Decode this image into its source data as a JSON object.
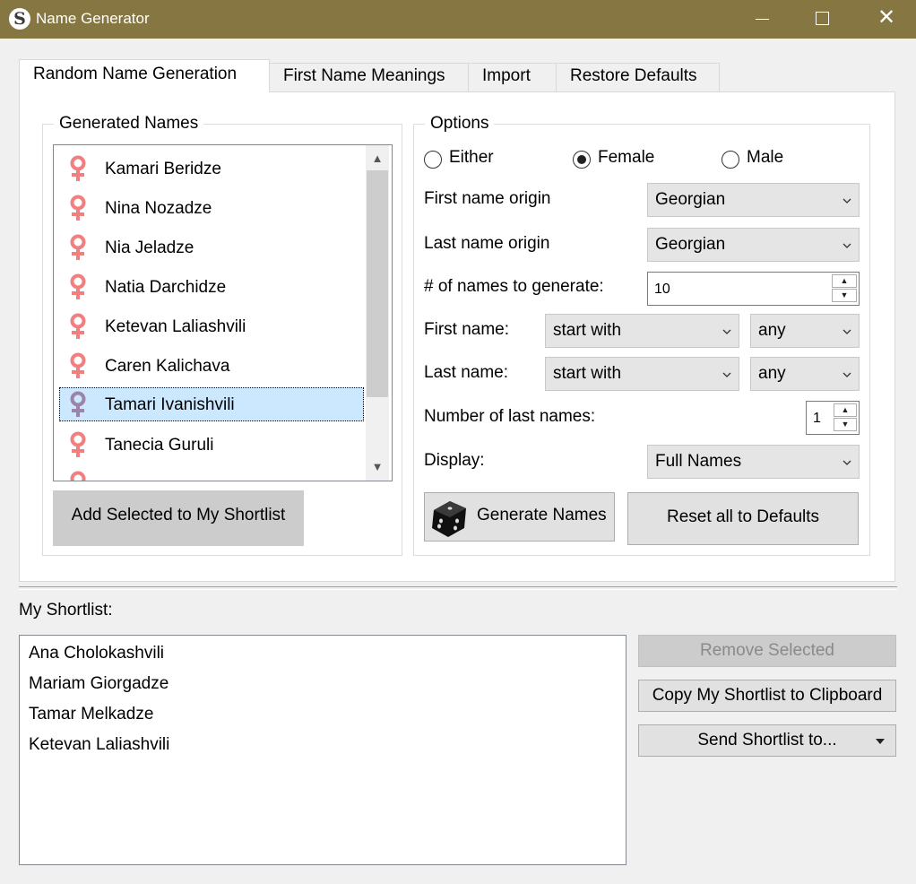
{
  "window": {
    "app_icon_letter": "S",
    "title": "Name Generator",
    "minimize_icon": "minimize-icon",
    "maximize_icon": "maximize-icon",
    "close_icon": "close-icon",
    "titlebar_color": "#867742"
  },
  "tabs": [
    {
      "label": "Random Name Generation",
      "active": true
    },
    {
      "label": "First Name Meanings",
      "active": false
    },
    {
      "label": "Import",
      "active": false
    },
    {
      "label": "Restore Defaults",
      "active": false
    }
  ],
  "generated": {
    "title": "Generated Names",
    "gender_icon": "female-symbol-icon",
    "names": [
      {
        "name": "Kamari Beridze",
        "selected": false
      },
      {
        "name": "Nina Nozadze",
        "selected": false
      },
      {
        "name": "Nia Jeladze",
        "selected": false
      },
      {
        "name": "Natia Darchidze",
        "selected": false
      },
      {
        "name": "Ketevan Laliashvili",
        "selected": false
      },
      {
        "name": "Caren Kalichava",
        "selected": false
      },
      {
        "name": "Tamari Ivanishvili",
        "selected": true
      },
      {
        "name": "Tanecia Guruli",
        "selected": false
      }
    ],
    "add_button": "Add Selected to My Shortlist",
    "female_color": "#f08080",
    "selected_color": "#cce8ff"
  },
  "options": {
    "title": "Options",
    "gender": {
      "either": "Either",
      "female": "Female",
      "male": "Male",
      "selected": "Female"
    },
    "first_origin_label": "First name origin",
    "first_origin_value": "Georgian",
    "last_origin_label": "Last name origin",
    "last_origin_value": "Georgian",
    "count_label": "# of names to generate:",
    "count_value": "10",
    "first_name_label": "First name:",
    "first_name_mode": "start with",
    "first_name_letter": "any",
    "last_name_label": "Last name:",
    "last_name_mode": "start with",
    "last_name_letter": "any",
    "num_last_label": "Number of last names:",
    "num_last_value": "1",
    "display_label": "Display:",
    "display_value": "Full Names",
    "generate_button": "Generate Names",
    "generate_icon": "dice-icon",
    "reset_button": "Reset all to Defaults"
  },
  "shortlist": {
    "title": "My Shortlist:",
    "items": [
      "Ana Cholokashvili",
      "Mariam Giorgadze",
      "Tamar Melkadze",
      "Ketevan Laliashvili"
    ],
    "remove_button": "Remove Selected",
    "copy_button": "Copy My Shortlist to Clipboard",
    "send_button": "Send Shortlist to..."
  }
}
